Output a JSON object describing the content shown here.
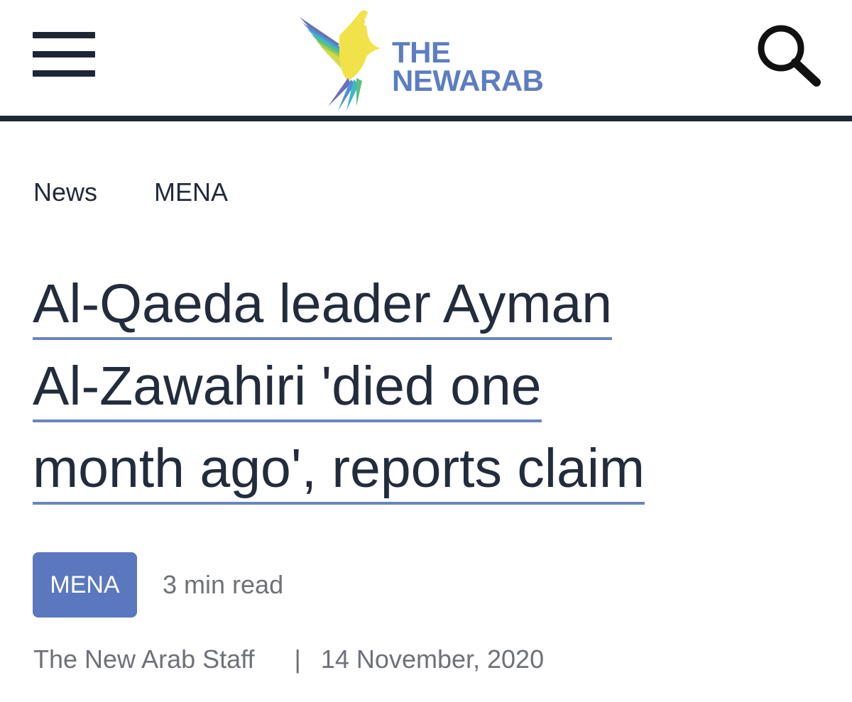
{
  "header": {
    "logo_line1": "THE",
    "logo_line2": "NEWARAB",
    "menu_icon": "hamburger-menu-icon",
    "search_icon": "search-icon"
  },
  "breadcrumb": {
    "items": [
      "News",
      "MENA"
    ]
  },
  "article": {
    "headline_lines": [
      "Al-Qaeda leader Ayman",
      "Al-Zawahiri 'died one",
      "month ago', reports claim"
    ],
    "category_tag": "MENA",
    "read_time": "3 min read",
    "author": "The New Arab Staff",
    "separator": "|",
    "date": "14 November, 2020"
  },
  "colors": {
    "brand_blue": "#5d7dc2",
    "tag_background": "#5b78bf",
    "headline_underline": "#6a84bf",
    "dark_text": "#232c3c",
    "muted_text": "#6e7178",
    "header_rule": "#1f2838"
  }
}
